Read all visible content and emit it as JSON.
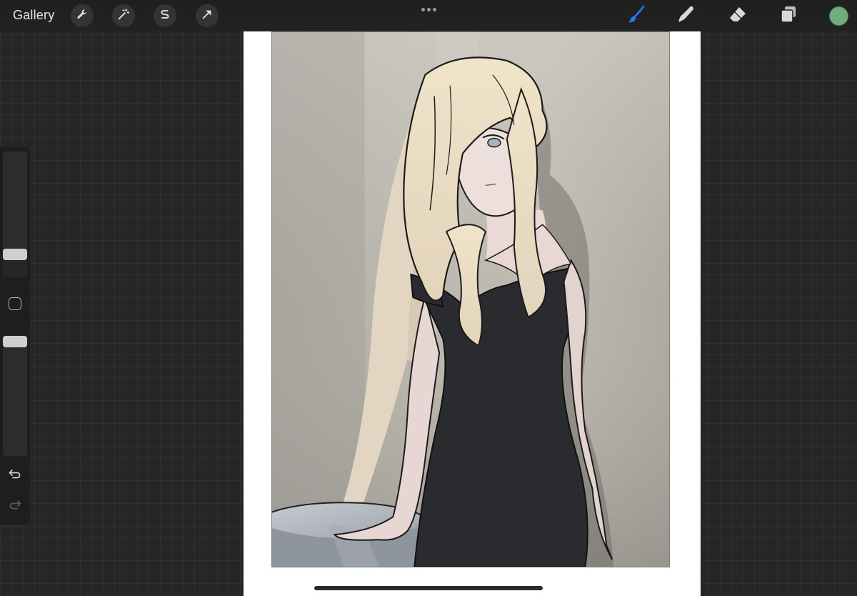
{
  "toolbar": {
    "gallery_label": "Gallery",
    "left_tools": [
      {
        "name": "actions",
        "icon": "wrench-icon"
      },
      {
        "name": "adjustments",
        "icon": "magic-wand-icon"
      },
      {
        "name": "selection",
        "icon": "selection-s-icon"
      },
      {
        "name": "transform",
        "icon": "arrow-cursor-icon"
      }
    ],
    "more_icon": "more-dots-icon",
    "right_tools": [
      {
        "name": "brush",
        "icon": "brush-icon",
        "active": true
      },
      {
        "name": "smudge",
        "icon": "smudge-finger-icon",
        "active": false
      },
      {
        "name": "eraser",
        "icon": "eraser-icon",
        "active": false
      },
      {
        "name": "layers",
        "icon": "layers-icon",
        "active": false
      }
    ],
    "current_color": "#6fae78",
    "active_tool_color": "#1d7cf2"
  },
  "sidebar": {
    "brush_size": 0.15,
    "brush_opacity": 1.0,
    "modify_icon": "square-modify-icon",
    "undo_icon": "undo-icon",
    "redo_icon": "redo-icon"
  },
  "canvas": {
    "background": "#ffffff",
    "artwork_description_icon": "illustration-canvas"
  }
}
